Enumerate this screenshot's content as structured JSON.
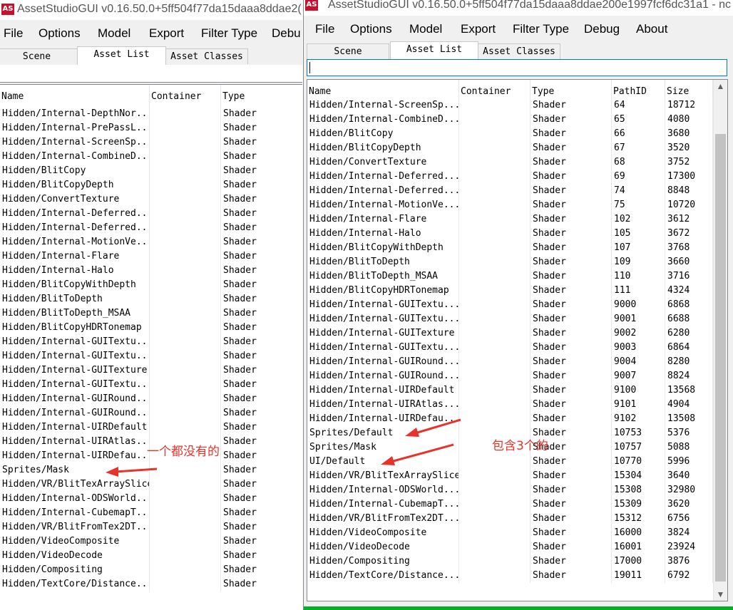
{
  "left_window": {
    "title": "AssetStudioGUI v0.16.50.0+5ff504f77da15daaa8ddae2(",
    "menu": [
      "File",
      "Options",
      "Model",
      "Export",
      "Filter Type",
      "Debu"
    ],
    "tabs": [
      "Scene Hierarchy",
      "Asset List",
      "Asset Classes"
    ],
    "selected_tab": "Asset List",
    "columns": [
      "Name",
      "Container",
      "Type"
    ],
    "rows": [
      [
        "Hidden/Internal-DepthNor...",
        "",
        "Shader"
      ],
      [
        "Hidden/Internal-PrePassL...",
        "",
        "Shader"
      ],
      [
        "Hidden/Internal-ScreenSp...",
        "",
        "Shader"
      ],
      [
        "Hidden/Internal-CombineD...",
        "",
        "Shader"
      ],
      [
        "Hidden/BlitCopy",
        "",
        "Shader"
      ],
      [
        "Hidden/BlitCopyDepth",
        "",
        "Shader"
      ],
      [
        "Hidden/ConvertTexture",
        "",
        "Shader"
      ],
      [
        "Hidden/Internal-Deferred...",
        "",
        "Shader"
      ],
      [
        "Hidden/Internal-Deferred...",
        "",
        "Shader"
      ],
      [
        "Hidden/Internal-MotionVe...",
        "",
        "Shader"
      ],
      [
        "Hidden/Internal-Flare",
        "",
        "Shader"
      ],
      [
        "Hidden/Internal-Halo",
        "",
        "Shader"
      ],
      [
        "Hidden/BlitCopyWithDepth",
        "",
        "Shader"
      ],
      [
        "Hidden/BlitToDepth",
        "",
        "Shader"
      ],
      [
        "Hidden/BlitToDepth_MSAA",
        "",
        "Shader"
      ],
      [
        "Hidden/BlitCopyHDRTonemap",
        "",
        "Shader"
      ],
      [
        "Hidden/Internal-GUITextu...",
        "",
        "Shader"
      ],
      [
        "Hidden/Internal-GUITextu...",
        "",
        "Shader"
      ],
      [
        "Hidden/Internal-GUITexture",
        "",
        "Shader"
      ],
      [
        "Hidden/Internal-GUITextu...",
        "",
        "Shader"
      ],
      [
        "Hidden/Internal-GUIRound...",
        "",
        "Shader"
      ],
      [
        "Hidden/Internal-GUIRound...",
        "",
        "Shader"
      ],
      [
        "Hidden/Internal-UIRDefault",
        "",
        "Shader"
      ],
      [
        "Hidden/Internal-UIRAtlas...",
        "",
        "Shader"
      ],
      [
        "Hidden/Internal-UIRDefau...",
        "",
        "Shader"
      ],
      [
        "Sprites/Mask",
        "",
        "Shader"
      ],
      [
        "Hidden/VR/BlitTexArraySlice",
        "",
        "Shader"
      ],
      [
        "Hidden/Internal-ODSWorld...",
        "",
        "Shader"
      ],
      [
        "Hidden/Internal-CubemapT...",
        "",
        "Shader"
      ],
      [
        "Hidden/VR/BlitFromTex2DT...",
        "",
        "Shader"
      ],
      [
        "Hidden/VideoComposite",
        "",
        "Shader"
      ],
      [
        "Hidden/VideoDecode",
        "",
        "Shader"
      ],
      [
        "Hidden/Compositing",
        "",
        "Shader"
      ],
      [
        "Hidden/TextCore/Distance...",
        "",
        "Shader"
      ]
    ],
    "annotation": "一个都没有的"
  },
  "right_window": {
    "title": "AssetStudioGUI v0.16.50.0+5ff504f77da15daaa8ddae200e1997fcf6dc31a1 - nc",
    "menu": [
      "File",
      "Options",
      "Model",
      "Export",
      "Filter Type",
      "Debug",
      "About"
    ],
    "tabs": [
      "Scene Hierarchy",
      "Asset List",
      "Asset Classes"
    ],
    "selected_tab": "Asset List",
    "filter_value": "",
    "columns": [
      "Name",
      "Container",
      "Type",
      "PathID",
      "Size"
    ],
    "rows": [
      [
        "Hidden/Internal-ScreenSp...",
        "",
        "Shader",
        "64",
        "18712"
      ],
      [
        "Hidden/Internal-CombineD...",
        "",
        "Shader",
        "65",
        "4080"
      ],
      [
        "Hidden/BlitCopy",
        "",
        "Shader",
        "66",
        "3680"
      ],
      [
        "Hidden/BlitCopyDepth",
        "",
        "Shader",
        "67",
        "3520"
      ],
      [
        "Hidden/ConvertTexture",
        "",
        "Shader",
        "68",
        "3752"
      ],
      [
        "Hidden/Internal-Deferred...",
        "",
        "Shader",
        "69",
        "17300"
      ],
      [
        "Hidden/Internal-Deferred...",
        "",
        "Shader",
        "74",
        "8848"
      ],
      [
        "Hidden/Internal-MotionVe...",
        "",
        "Shader",
        "75",
        "10720"
      ],
      [
        "Hidden/Internal-Flare",
        "",
        "Shader",
        "102",
        "3612"
      ],
      [
        "Hidden/Internal-Halo",
        "",
        "Shader",
        "105",
        "3672"
      ],
      [
        "Hidden/BlitCopyWithDepth",
        "",
        "Shader",
        "107",
        "3768"
      ],
      [
        "Hidden/BlitToDepth",
        "",
        "Shader",
        "109",
        "3660"
      ],
      [
        "Hidden/BlitToDepth_MSAA",
        "",
        "Shader",
        "110",
        "3716"
      ],
      [
        "Hidden/BlitCopyHDRTonemap",
        "",
        "Shader",
        "111",
        "4324"
      ],
      [
        "Hidden/Internal-GUITextu...",
        "",
        "Shader",
        "9000",
        "6868"
      ],
      [
        "Hidden/Internal-GUITextu...",
        "",
        "Shader",
        "9001",
        "6688"
      ],
      [
        "Hidden/Internal-GUITexture",
        "",
        "Shader",
        "9002",
        "6280"
      ],
      [
        "Hidden/Internal-GUITextu...",
        "",
        "Shader",
        "9003",
        "6864"
      ],
      [
        "Hidden/Internal-GUIRound...",
        "",
        "Shader",
        "9004",
        "8280"
      ],
      [
        "Hidden/Internal-GUIRound...",
        "",
        "Shader",
        "9007",
        "8824"
      ],
      [
        "Hidden/Internal-UIRDefault",
        "",
        "Shader",
        "9100",
        "13568"
      ],
      [
        "Hidden/Internal-UIRAtlas...",
        "",
        "Shader",
        "9101",
        "4904"
      ],
      [
        "Hidden/Internal-UIRDefau...",
        "",
        "Shader",
        "9102",
        "13508"
      ],
      [
        "Sprites/Default",
        "",
        "Shader",
        "10753",
        "5376"
      ],
      [
        "Sprites/Mask",
        "",
        "Shader",
        "10757",
        "5088"
      ],
      [
        "UI/Default",
        "",
        "Shader",
        "10770",
        "5996"
      ],
      [
        "Hidden/VR/BlitTexArraySlice",
        "",
        "Shader",
        "15304",
        "3640"
      ],
      [
        "Hidden/Internal-ODSWorld...",
        "",
        "Shader",
        "15308",
        "32980"
      ],
      [
        "Hidden/Internal-CubemapT...",
        "",
        "Shader",
        "15309",
        "3620"
      ],
      [
        "Hidden/VR/BlitFromTex2DT...",
        "",
        "Shader",
        "15312",
        "6756"
      ],
      [
        "Hidden/VideoComposite",
        "",
        "Shader",
        "16000",
        "3824"
      ],
      [
        "Hidden/VideoDecode",
        "",
        "Shader",
        "16001",
        "23924"
      ],
      [
        "Hidden/Compositing",
        "",
        "Shader",
        "17000",
        "3876"
      ],
      [
        "Hidden/TextCore/Distance...",
        "",
        "Shader",
        "19011",
        "6792"
      ]
    ],
    "annotation": "包含3个的"
  },
  "icons": {
    "app_icon": "AS",
    "scroll_up": "▲",
    "scroll_down": "▼"
  },
  "colors": {
    "annotation": "#e8332a",
    "app_icon": "#c8102e",
    "progress": "#06b025"
  }
}
